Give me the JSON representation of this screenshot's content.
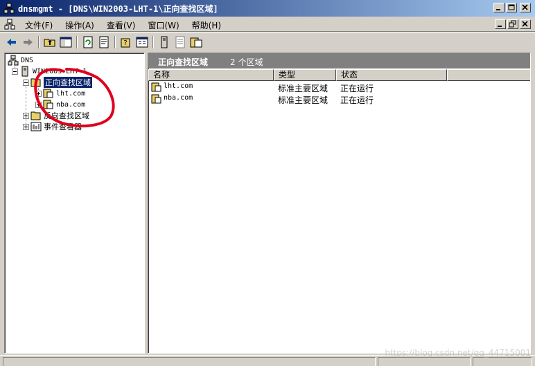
{
  "window": {
    "title": "dnsmgmt - [DNS\\WIN2003-LHT-1\\正向查找区域]"
  },
  "menu": [
    "文件(F)",
    "操作(A)",
    "查看(V)",
    "窗口(W)",
    "帮助(H)"
  ],
  "tree": {
    "root": "DNS",
    "server": "WIN2003-LHT-1",
    "forward_zone": "正向查找区域",
    "zones": [
      "lht.com",
      "nba.com"
    ],
    "reverse_zone": "反向查找区域",
    "event_viewer": "事件查看器"
  },
  "list": {
    "header_title": "正向查找区域",
    "header_count": "2 个区域",
    "columns": [
      "名称",
      "类型",
      "状态"
    ],
    "rows": [
      {
        "name": "lht.com",
        "type": "标准主要区域",
        "status": "正在运行"
      },
      {
        "name": "nba.com",
        "type": "标准主要区域",
        "status": "正在运行"
      }
    ]
  },
  "watermark": "https://blog.csdn.net/qq_44715001",
  "colors": {
    "title_active": "#0a246a",
    "title_fade": "#a6caf0",
    "face": "#d4d0c8",
    "band": "#808080",
    "annotation": "#e0001c"
  }
}
